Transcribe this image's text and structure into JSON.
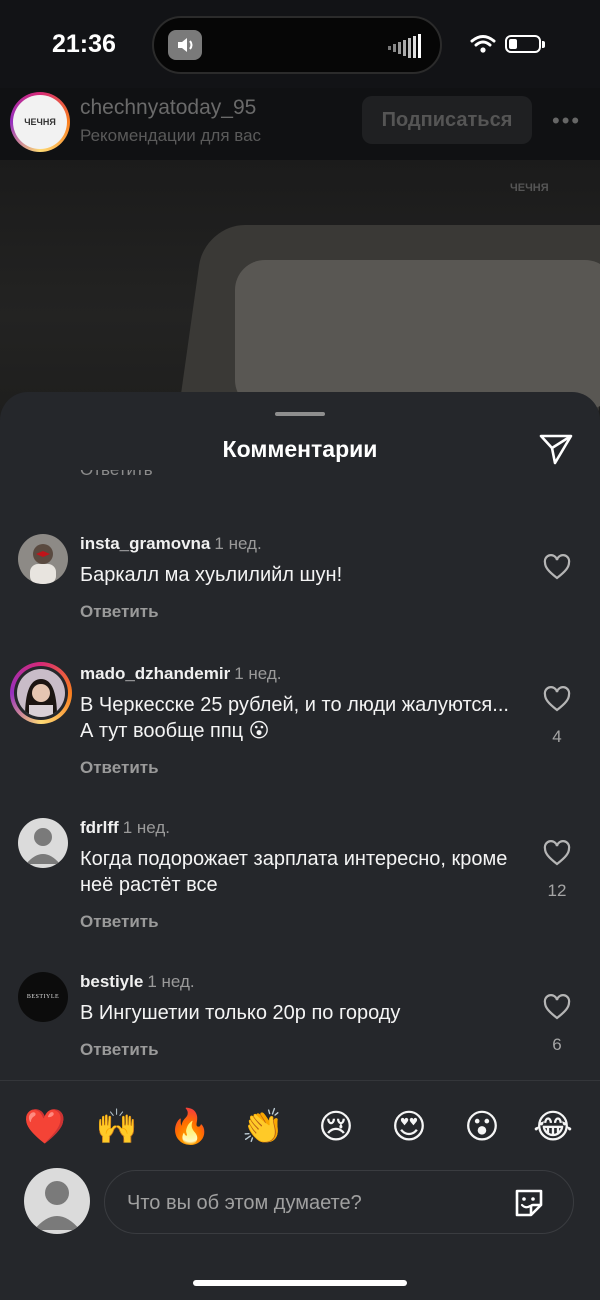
{
  "status_bar": {
    "time": "21:36"
  },
  "post": {
    "username": "chechnyatoday_95",
    "subtitle": "Рекомендации для вас",
    "follow_label": "Подписаться",
    "more_label": "•••",
    "logo_text": "ЧЕЧНЯ"
  },
  "comments_sheet": {
    "title": "Комментарии",
    "clipped_reply": "Ответить",
    "comments": [
      {
        "user": "insta_gramovna",
        "time": "1 нед.",
        "text": "Баркалл ма хуьлилийл шун!",
        "reply": "Ответить",
        "likes": ""
      },
      {
        "user": "mado_dzhandemir",
        "time": "1 нед.",
        "text": "В Черкесске 25 рублей, и то люди жалуются... А тут вообще ппц 😮",
        "reply": "Ответить",
        "likes": "4"
      },
      {
        "user": "fdrlff",
        "time": "1 нед.",
        "text": "Когда подорожает зарплата интересно, кроме неё растёт все",
        "reply": "Ответить",
        "likes": "12"
      },
      {
        "user": "bestiyle",
        "time": "1 нед.",
        "text": "В Ингушетии только 20р по городу",
        "reply": "Ответить",
        "likes": "6"
      }
    ],
    "avatar_texts": {
      "bestiyle": "BESTIYLE"
    }
  },
  "quick_reactions": [
    "❤️",
    "🙌",
    "🔥",
    "👏",
    "😢",
    "😍",
    "😮",
    "😂"
  ],
  "composer": {
    "placeholder": "Что вы об этом думаете?"
  },
  "icons": [
    "speaker-icon",
    "signal-icon",
    "wifi-icon",
    "battery-icon",
    "share-send-icon",
    "heart-icon",
    "sticker-icon",
    "default-avatar-icon"
  ]
}
